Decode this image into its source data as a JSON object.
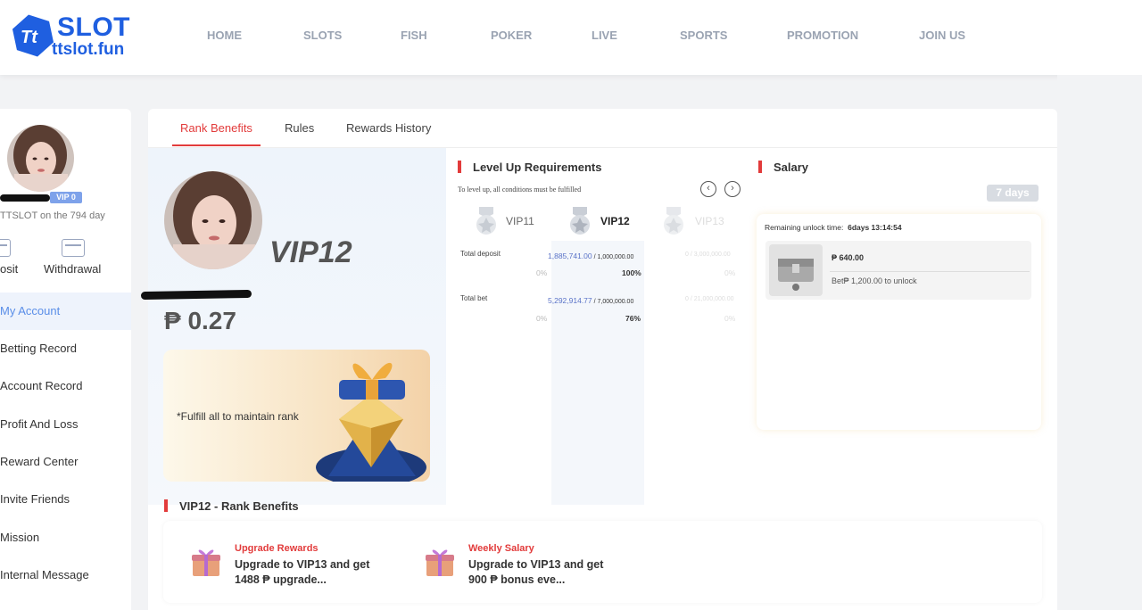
{
  "brand": {
    "name": "SLOT",
    "domain": "ttslot.fun",
    "badge_text": "Tt",
    "color": "#1f5fe0"
  },
  "nav": {
    "items": [
      "HOME",
      "SLOTS",
      "FISH",
      "POKER",
      "LIVE",
      "SPORTS",
      "PROMOTION",
      "JOIN US"
    ]
  },
  "profile": {
    "vip_badge": "VIP 0",
    "days_text": "TTSLOT on the 794 day",
    "deposit_label": "osit",
    "withdrawal_label": "Withdrawal"
  },
  "sidebar": {
    "items": [
      {
        "label": "My Account",
        "active": true
      },
      {
        "label": "Betting Record"
      },
      {
        "label": "Account Record"
      },
      {
        "label": "Profit And Loss"
      },
      {
        "label": "Reward Center"
      },
      {
        "label": "Invite Friends"
      },
      {
        "label": "Mission"
      },
      {
        "label": "Internal Message"
      }
    ]
  },
  "tabs": [
    "Rank Benefits",
    "Rules",
    "Rewards History"
  ],
  "rank": {
    "vip_level": "VIP12",
    "balance": "₱ 0.27",
    "promo_text": "*Fulfill all to maintain rank"
  },
  "level_up": {
    "title": "Level Up Requirements",
    "hint": "To level up, all conditions must be fulfilled",
    "prev_icon": "chevron-left-icon",
    "next_icon": "chevron-right-icon",
    "levels": [
      "VIP11",
      "VIP12",
      "VIP13"
    ],
    "rows": [
      {
        "label": "Total deposit",
        "current_value": "1,885,741.00",
        "current_target": " / 1,000,000.00",
        "current_pct": "100%",
        "prev_pct": "0%",
        "next_value": "0 / 3,000,000.00",
        "next_pct": "0%"
      },
      {
        "label": "Total bet",
        "current_value": "5,292,914.77",
        "current_target": " / 7,000,000.00",
        "current_pct": "76%",
        "prev_pct": "0%",
        "next_value": "0 / 21,000,000.00",
        "next_pct": "0%"
      }
    ]
  },
  "salary": {
    "title": "Salary",
    "period": "7 days",
    "unlock_label": "Remaining unlock time:",
    "unlock_time": "6days  13:14:54",
    "amount": "₱  640.00",
    "bet_requirement": "Bet₱  1,200.00 to unlock"
  },
  "benefits": {
    "title": "VIP12 - Rank Benefits",
    "items": [
      {
        "tag": "Upgrade Rewards",
        "desc": "Upgrade to VIP13 and get 1488 ₱ upgrade..."
      },
      {
        "tag": "Weekly Salary",
        "desc": "Upgrade to VIP13 and get 900 ₱ bonus eve..."
      }
    ]
  },
  "colors": {
    "accent_red": "#e23b3b",
    "link_blue": "#5a8ee8",
    "vip_badge": "#7ea2ea"
  }
}
